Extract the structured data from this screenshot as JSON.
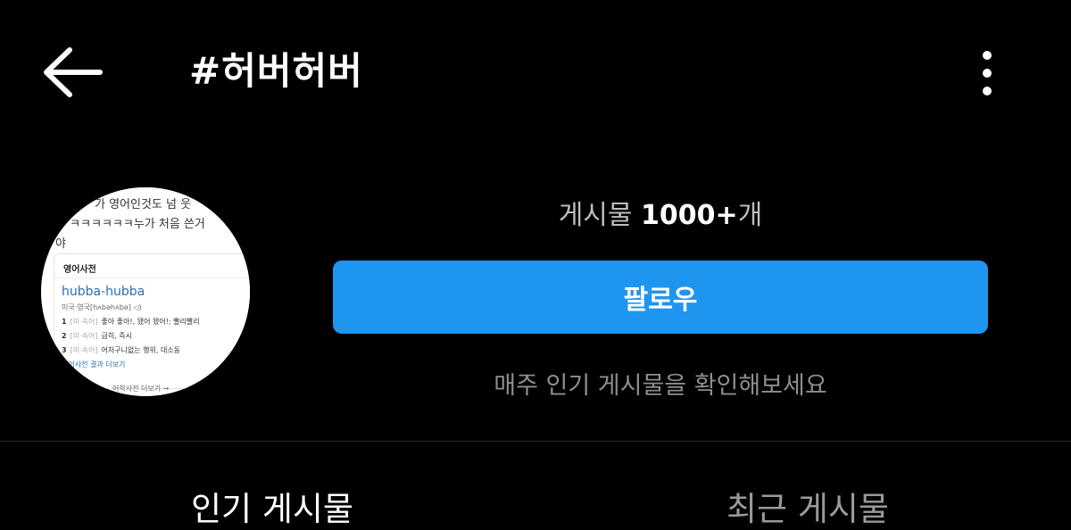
{
  "header": {
    "title": "#허버허버",
    "back_icon": "arrow-left-icon",
    "more_icon": "more-vertical-icon"
  },
  "avatar": {
    "snippet_line1": "가 영어인것도 넘 웃",
    "snippet_line2": "ㅋ ㅋㅋㅋㅋㅋㅋ누가 처음 쓴거",
    "snippet_line3": "야",
    "section_title": "영어사전",
    "word": "hubba-hubba",
    "pronunciation": "미국·영국[hʌbəhʌbə]",
    "definitions": [
      {
        "num": "1",
        "tag": "[미·속어]",
        "text": "좋아 좋아!, 됐어 됐어!; 빨리빨리"
      },
      {
        "num": "2",
        "tag": "[미·속어]",
        "text": "급히, 즉시"
      },
      {
        "num": "3",
        "tag": "[미·속어]",
        "text": "어처구니없는 행위, 대소동"
      }
    ],
    "more_link": "영어사전 결과 더보기",
    "footer_link": "어학사전 더보기 →"
  },
  "stats": {
    "posts_label": "게시물",
    "posts_count": "1000+",
    "posts_suffix": "개"
  },
  "follow_button": "팔로우",
  "weekly_text": "매주 인기 게시물을 확인해보세요",
  "tabs": [
    {
      "label": "인기 게시물",
      "active": true
    },
    {
      "label": "최근 게시물",
      "active": false
    }
  ],
  "colors": {
    "background": "#000000",
    "follow_button": "#1e96f0",
    "muted_text": "#8e8e8e"
  }
}
